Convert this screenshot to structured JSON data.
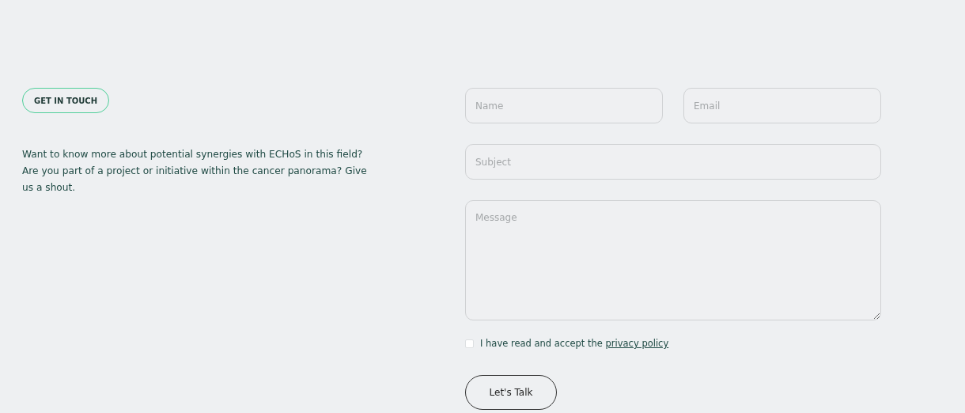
{
  "badge": "GET IN TOUCH",
  "intro": "Want to know more about potential synergies with ECHoS in this field? Are you part of a project or initiative within the cancer panorama? Give us a shout.",
  "form": {
    "name": {
      "placeholder": "Name"
    },
    "email": {
      "placeholder": "Email"
    },
    "subject": {
      "placeholder": "Subject"
    },
    "message": {
      "placeholder": "Message"
    },
    "consent": {
      "checked": false,
      "text": "I have read and accept the ",
      "link": "privacy policy"
    },
    "submit": "Let's Talk"
  }
}
